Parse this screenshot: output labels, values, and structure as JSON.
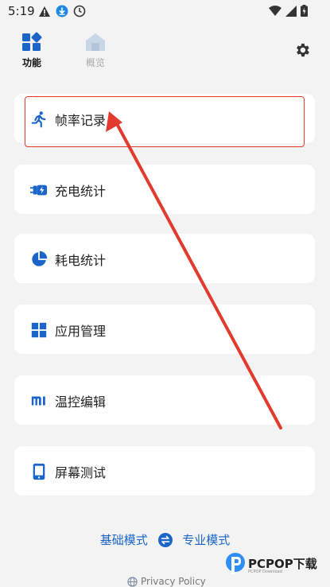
{
  "status_bar": {
    "time": "5:19"
  },
  "tabs": [
    {
      "label": "功能",
      "active": true
    },
    {
      "label": "概览",
      "active": false
    }
  ],
  "cards": [
    {
      "label": "帧率记录",
      "icon": "running-person-icon"
    },
    {
      "label": "充电统计",
      "icon": "charging-plug-icon"
    },
    {
      "label": "耗电统计",
      "icon": "pie-chart-icon"
    },
    {
      "label": "应用管理",
      "icon": "grid-apps-icon"
    },
    {
      "label": "温控编辑",
      "icon": "mi-logo-icon"
    },
    {
      "label": "屏幕测试",
      "icon": "phone-screen-icon"
    }
  ],
  "mode": {
    "basic_label": "基础模式",
    "pro_label": "专业模式"
  },
  "privacy": {
    "label": "Privacy Policy"
  },
  "watermark": {
    "brand": "PCPOP下载",
    "sub": "PCPOP Download"
  },
  "colors": {
    "accent": "#1b65c9",
    "annotation": "#e23b2e",
    "background": "#f3f3f3",
    "card": "#ffffff"
  }
}
